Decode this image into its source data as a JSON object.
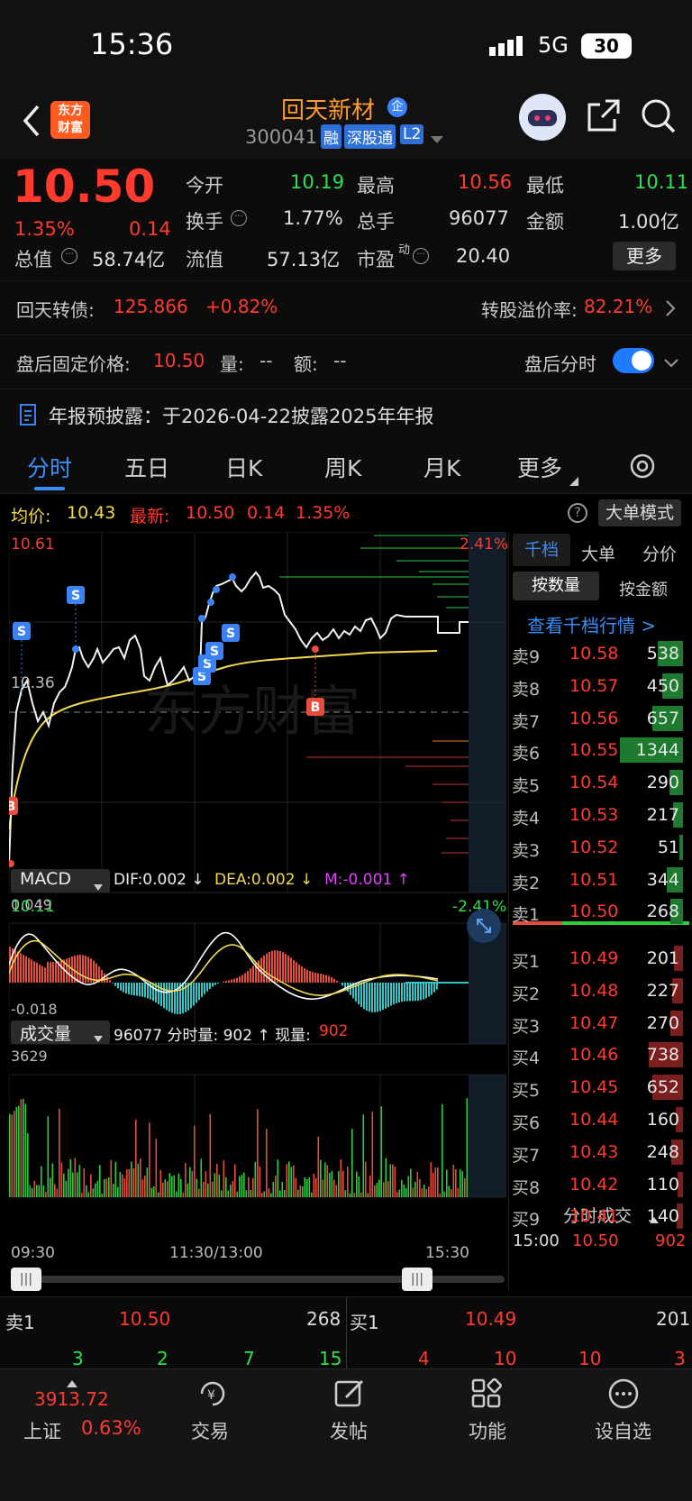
{
  "status": {
    "time": "15:36",
    "network": "5G",
    "battery": "30"
  },
  "header": {
    "logo_line1": "东方",
    "logo_line2": "财富",
    "name": "回天新材",
    "name_badge": "企",
    "code": "300041",
    "tags": [
      "融",
      "深股通",
      "L2"
    ]
  },
  "quote": {
    "price": "10.50",
    "pct": "1.35%",
    "chg": "0.14",
    "fields": [
      [
        "今开",
        "10.19"
      ],
      [
        "最高",
        "10.56"
      ],
      [
        "最低",
        "10.11"
      ],
      [
        "换手",
        "1.77%"
      ],
      [
        "总手",
        "96077"
      ],
      [
        "金额",
        "1.00亿"
      ],
      [
        "总值",
        "58.74亿"
      ],
      [
        "流值",
        "57.13亿"
      ],
      [
        "市盈",
        "20.40"
      ]
    ],
    "more": "更多",
    "pe_sup": "动"
  },
  "bond": {
    "label": "回天转债:",
    "price": "125.866",
    "chg": "+0.82%",
    "premium_label": "转股溢价率:",
    "premium": "82.21%"
  },
  "afterhours": {
    "label": "盘后固定价格:",
    "price": "10.50",
    "vol_label": "量:",
    "vol": "--",
    "amt_label": "额:",
    "amt": "--",
    "toggle_label": "盘后分时"
  },
  "notice": {
    "text": "年报预披露：于2026-04-22披露2025年年报"
  },
  "tabs": [
    "分时",
    "五日",
    "日K",
    "周K",
    "月K",
    "更多"
  ],
  "info": {
    "avg_label": "均价:",
    "avg": "10.43",
    "latest_label": "最新:",
    "latest": "10.50",
    "chg": "0.14",
    "pct": "1.35%",
    "mode": "大单模式"
  },
  "chart": {
    "top": "10.61",
    "bottom": "10.11",
    "mid": "10.36",
    "top_pct": "2.41%",
    "bottom_pct": "-2.41%",
    "watermark": "东方财富"
  },
  "macd": {
    "label": "MACD",
    "dif": "DIF:0.002 ↓",
    "dea": "DEA:0.002 ↓",
    "m": "M:-0.001 ↑",
    "top": "0.049",
    "bottom": "-0.018"
  },
  "volume": {
    "label": "成交量",
    "text1": "96077 分时量: 902 ↑ 现量:",
    "now": "902",
    "top": "3629"
  },
  "times": [
    "09:30",
    "11:30/13:00",
    "15:30"
  ],
  "depth": {
    "tabs": [
      "千档",
      "大单",
      "分价"
    ],
    "sub": [
      "按数量",
      "按金额"
    ],
    "link": "查看千档行情 >",
    "asks": [
      [
        "卖9",
        "10.58",
        "538"
      ],
      [
        "卖8",
        "10.57",
        "450"
      ],
      [
        "卖7",
        "10.56",
        "657"
      ],
      [
        "卖6",
        "10.55",
        "1344"
      ],
      [
        "卖5",
        "10.54",
        "290"
      ],
      [
        "卖4",
        "10.53",
        "217"
      ],
      [
        "卖3",
        "10.52",
        "51"
      ],
      [
        "卖2",
        "10.51",
        "344"
      ],
      [
        "卖1",
        "10.50",
        "268"
      ]
    ],
    "bids": [
      [
        "买1",
        "10.49",
        "201"
      ],
      [
        "买2",
        "10.48",
        "227"
      ],
      [
        "买3",
        "10.47",
        "270"
      ],
      [
        "买4",
        "10.46",
        "738"
      ],
      [
        "买5",
        "10.45",
        "652"
      ],
      [
        "买6",
        "10.44",
        "160"
      ],
      [
        "买7",
        "10.43",
        "248"
      ],
      [
        "买8",
        "10.42",
        "110"
      ],
      [
        "买9",
        "10.41",
        "140"
      ]
    ],
    "trades_label": "分时成交",
    "trade": [
      "15:00",
      "10.50",
      "902"
    ]
  },
  "strip": {
    "sell_label": "卖1",
    "sell_price": "10.50",
    "sell_vol": "268",
    "buy_label": "买1",
    "buy_price": "10.49",
    "buy_vol": "201",
    "left_nums": [
      "3",
      "2",
      "7",
      "15"
    ],
    "right_nums": [
      "4",
      "10",
      "10",
      "3"
    ]
  },
  "bottom": {
    "index_value": "3913.72",
    "index_name": "上证",
    "index_pct": "0.63%",
    "items": [
      "交易",
      "发帖",
      "功能",
      "设自选"
    ]
  }
}
